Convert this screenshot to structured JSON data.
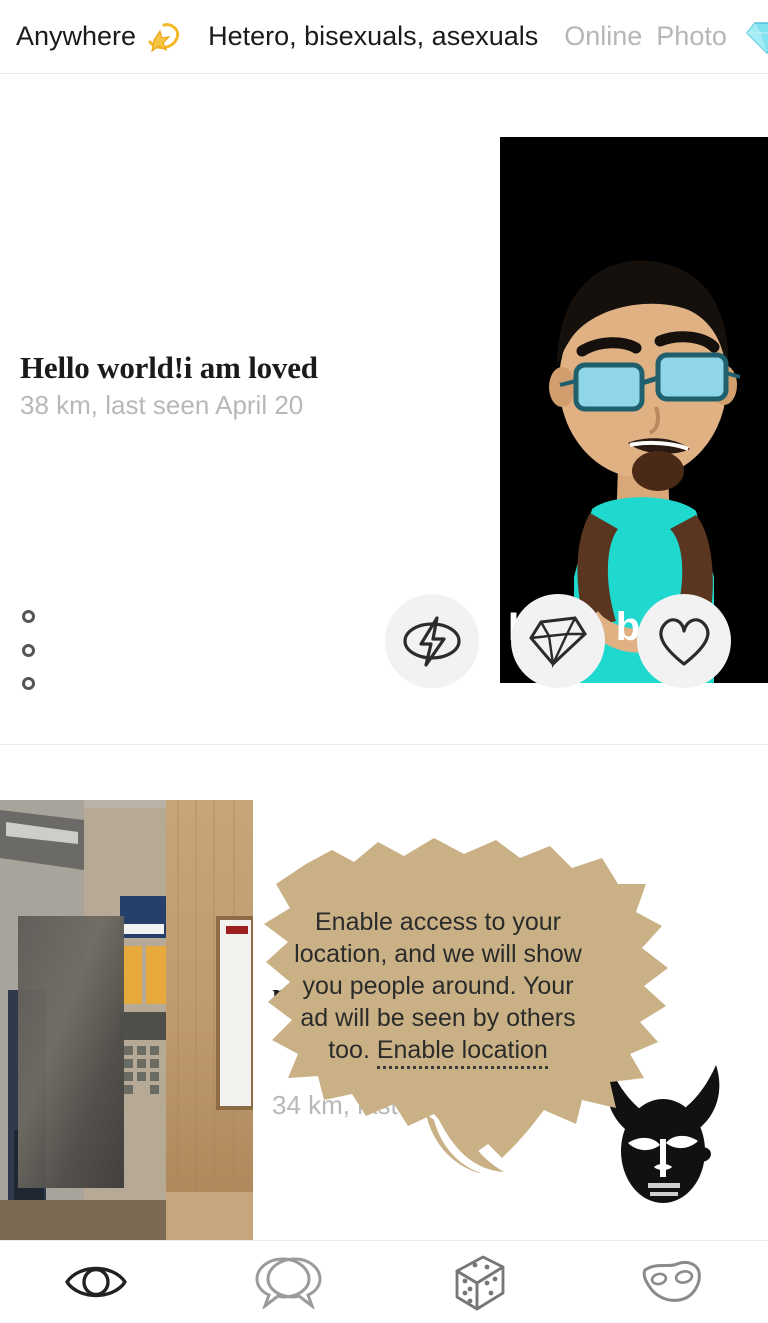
{
  "filters": {
    "location": "Anywhere",
    "location_icon": "comet-icon",
    "orientation": "Hetero, bisexuals, asexuals",
    "online": "Online",
    "photo": "Photo",
    "gem_icon": "gem-icon",
    "accent_gold": "#f2b21c",
    "gem_color": "#66d9e8"
  },
  "cards": [
    {
      "title": "Hello world!i am loved",
      "meta": "38 km, last seen April 20",
      "photo_caption": "I'm ... be",
      "photo_type": "cartoon-avatar-glasses",
      "shirt_color": "#1fd9cf",
      "bg_color": "#000000",
      "menu_icon": "kebab-menu-icon",
      "actions": [
        {
          "name": "zap-button",
          "icon": "lightning-bolt-icon"
        },
        {
          "name": "gem-button",
          "icon": "diamond-icon"
        },
        {
          "name": "like-button",
          "icon": "heart-icon"
        }
      ]
    },
    {
      "title": "makati. s passionate abou",
      "meta": "34 km, last seen April 6",
      "photo_type": "blurred-person-indoor",
      "avatar_icon": "horned-mask-icon"
    }
  ],
  "tooltip": {
    "body": "Enable access to your location, and we will show you people around. Your ad will be seen by others too.",
    "link": "Enable location",
    "color": "#c9b185"
  },
  "bottom_nav": [
    {
      "name": "nav-browse",
      "icon": "eye-icon",
      "active": true
    },
    {
      "name": "nav-chats",
      "icon": "speech-bubbles-icon",
      "active": false
    },
    {
      "name": "nav-game",
      "icon": "dice-icon",
      "active": false
    },
    {
      "name": "nav-profile",
      "icon": "mask-icon",
      "active": false
    }
  ]
}
